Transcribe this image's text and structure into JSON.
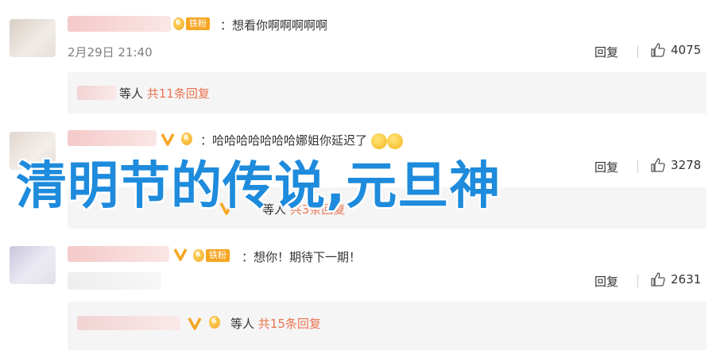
{
  "comments": [
    {
      "text": "：想看你啊啊啊啊啊",
      "fan_tag": "铁粉",
      "time": "2月29日 21:40",
      "reply_label": "回复",
      "likes": "4075",
      "sub": {
        "prefix": "等人",
        "count": "共11条回复"
      }
    },
    {
      "text": "：哈哈哈哈哈哈哈娜姐你延迟了",
      "reply_label": "回复",
      "likes": "3278",
      "sub": {
        "prefix": "等人",
        "count": "共3条回复"
      }
    },
    {
      "text": "：想你！期待下一期！",
      "fan_tag": "铁粉",
      "reply_label": "回复",
      "likes": "2631",
      "sub": {
        "prefix": "等人",
        "count": "共15条回复"
      }
    }
  ],
  "overlay": {
    "title": "清明节的传说,元旦神"
  },
  "colors": {
    "accent": "#eb7350",
    "overlay": "#1e8bdc",
    "badge_v": "#f6a623"
  },
  "icons": [
    "thumb-up-icon",
    "verified-v-icon",
    "fan-badge-icon",
    "emoji-icon"
  ]
}
